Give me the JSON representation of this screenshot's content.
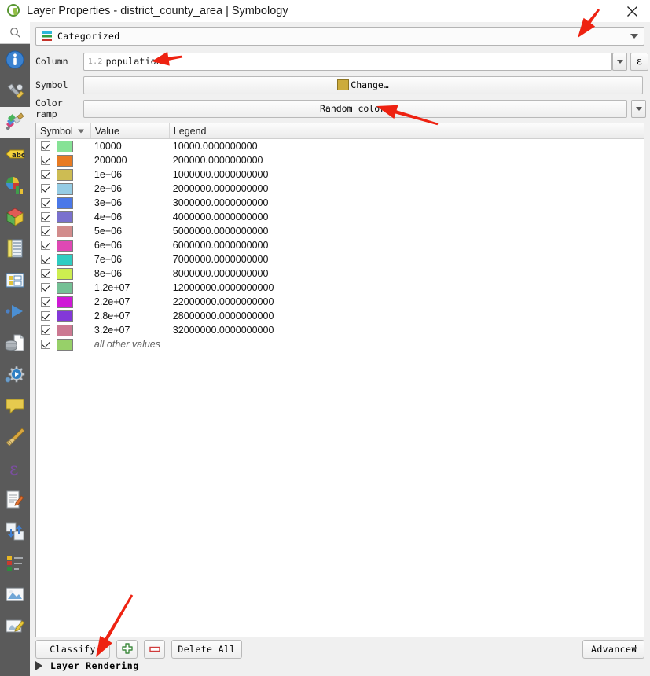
{
  "window": {
    "title": "Layer Properties - district_county_area | Symbology",
    "app_icon": "qgis-logo-icon",
    "close_icon": "close-icon"
  },
  "sidebar": {
    "search_icon": "search-icon",
    "items": [
      {
        "name": "information",
        "icon": "info-icon"
      },
      {
        "name": "source",
        "icon": "wrench-screwdriver-icon"
      },
      {
        "name": "symbology",
        "icon": "paintbrush-palette-icon",
        "active": true
      },
      {
        "name": "labels",
        "icon": "abc-label-icon"
      },
      {
        "name": "diagrams",
        "icon": "pie-bar-chart-icon"
      },
      {
        "name": "3d-view",
        "icon": "cube-icon"
      },
      {
        "name": "fields",
        "icon": "table-fields-icon"
      },
      {
        "name": "attributes-form",
        "icon": "form-layout-icon"
      },
      {
        "name": "joins",
        "icon": "join-arrow-icon"
      },
      {
        "name": "auxiliary-storage",
        "icon": "database-page-icon"
      },
      {
        "name": "actions",
        "icon": "gear-play-icon"
      },
      {
        "name": "display",
        "icon": "speech-bubble-icon"
      },
      {
        "name": "rendering",
        "icon": "broom-icon"
      },
      {
        "name": "variables",
        "icon": "epsilon-icon"
      },
      {
        "name": "metadata",
        "icon": "document-pencil-icon"
      },
      {
        "name": "dependencies",
        "icon": "refresh-arrows-icon"
      },
      {
        "name": "legend",
        "icon": "legend-list-icon"
      },
      {
        "name": "qgis-server",
        "icon": "image-frame-icon"
      },
      {
        "name": "digitizing",
        "icon": "map-pencil-icon"
      }
    ]
  },
  "renderer": {
    "label": "Categorized",
    "icon": "categorized-icon",
    "dropdown_icon": "chevron-down-icon"
  },
  "form": {
    "column": {
      "label": "Column",
      "field_type_tag": "1.2",
      "value": "population",
      "dropdown_icon": "chevron-down-icon",
      "expression_button": "ε"
    },
    "symbol": {
      "label": "Symbol",
      "change_label": "Change…",
      "swatch_color": "#ccab3b"
    },
    "color_ramp": {
      "label": "Color ramp",
      "value": "Random colors",
      "dropdown_icon": "chevron-down-icon"
    }
  },
  "table": {
    "headers": [
      "Symbol",
      "Value",
      "Legend"
    ],
    "sort_icon": "chevron-down-icon",
    "rows": [
      {
        "checked": true,
        "color": "#86e296",
        "value": "10000",
        "legend": "10000.0000000000"
      },
      {
        "checked": true,
        "color": "#e87b22",
        "value": "200000",
        "legend": "200000.0000000000"
      },
      {
        "checked": true,
        "color": "#cdbc53",
        "value": "1e+06",
        "legend": "1000000.0000000000"
      },
      {
        "checked": true,
        "color": "#95cce4",
        "value": "2e+06",
        "legend": "2000000.0000000000"
      },
      {
        "checked": true,
        "color": "#4a78e8",
        "value": "3e+06",
        "legend": "3000000.0000000000"
      },
      {
        "checked": true,
        "color": "#7a71ce",
        "value": "4e+06",
        "legend": "4000000.0000000000"
      },
      {
        "checked": true,
        "color": "#d28c8c",
        "value": "5e+06",
        "legend": "5000000.0000000000"
      },
      {
        "checked": true,
        "color": "#df48b4",
        "value": "6e+06",
        "legend": "6000000.0000000000"
      },
      {
        "checked": true,
        "color": "#2ecdc2",
        "value": "7e+06",
        "legend": "7000000.0000000000"
      },
      {
        "checked": true,
        "color": "#cdee50",
        "value": "8e+06",
        "legend": "8000000.0000000000"
      },
      {
        "checked": true,
        "color": "#74c095",
        "value": "1.2e+07",
        "legend": "12000000.0000000000"
      },
      {
        "checked": true,
        "color": "#cf18d6",
        "value": "2.2e+07",
        "legend": "22000000.0000000000"
      },
      {
        "checked": true,
        "color": "#8338d8",
        "value": "2.8e+07",
        "legend": "28000000.0000000000"
      },
      {
        "checked": true,
        "color": "#cc7992",
        "value": "3.2e+07",
        "legend": "32000000.0000000000"
      },
      {
        "checked": true,
        "color": "#97d069",
        "value": "all other values",
        "legend": "",
        "is_other": true
      }
    ]
  },
  "footer": {
    "classify_label": "Classify",
    "add_icon": "plus-icon",
    "remove_icon": "minus-icon",
    "delete_all_label": "Delete All",
    "advanced_label": "Advanced",
    "advanced_dropdown_icon": "chevron-down-icon",
    "layer_rendering_label": "Layer Rendering",
    "layer_rendering_toggle_icon": "triangle-right-icon"
  },
  "annotations": {
    "arrow_color": "#ee2211",
    "arrows": [
      {
        "name": "arrow-to-renderer-combo"
      },
      {
        "name": "arrow-to-column-field"
      },
      {
        "name": "arrow-to-color-ramp"
      },
      {
        "name": "arrow-to-classify-button"
      }
    ]
  }
}
